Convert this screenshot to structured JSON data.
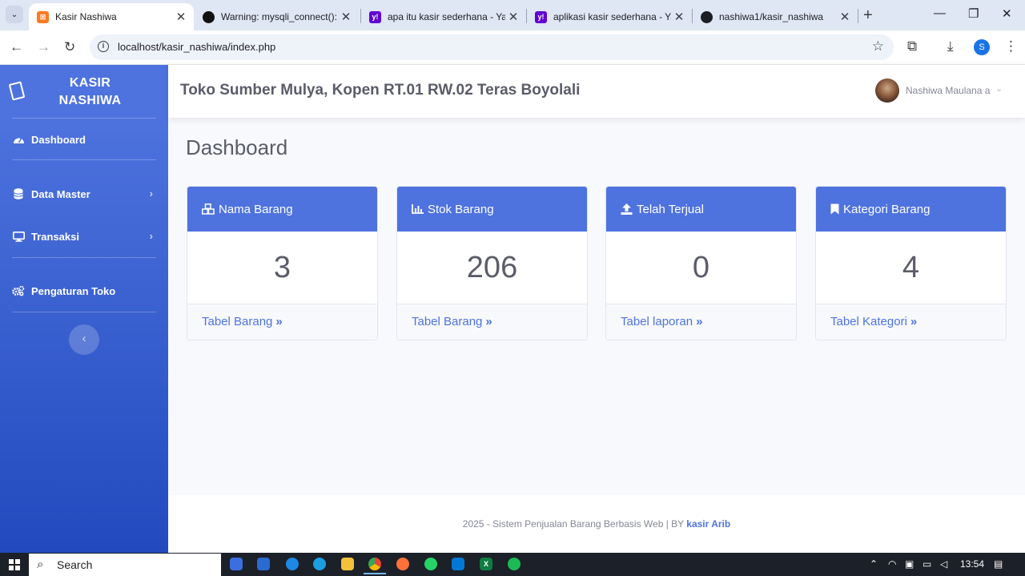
{
  "browser": {
    "tabs": [
      {
        "title": "Kasir Nashiwa",
        "favicon": "xampp-icon",
        "active": true
      },
      {
        "title": "Warning: mysqli_connect(): (",
        "favicon": "web-icon",
        "active": false
      },
      {
        "title": "apa itu kasir sederhana - Yah",
        "favicon": "yahoo-icon",
        "active": false
      },
      {
        "title": "aplikasi kasir sederhana - Yah",
        "favicon": "yahoo-icon",
        "active": false
      },
      {
        "title": "nashiwa1/kasir_nashiwa",
        "favicon": "github-icon",
        "active": false
      }
    ],
    "url": "localhost/kasir_nashiwa/index.php",
    "profile_initial": "S"
  },
  "sidebar": {
    "brand_line1": "KASIR",
    "brand_line2": "NASHIWA",
    "items": [
      {
        "label": "Dashboard",
        "icon": "tachometer-icon",
        "has_submenu": false
      },
      {
        "label": "Data Master",
        "icon": "database-icon",
        "has_submenu": true
      },
      {
        "label": "Transaksi",
        "icon": "desktop-icon",
        "has_submenu": true
      },
      {
        "label": "Pengaturan Toko",
        "icon": "cogs-icon",
        "has_submenu": false
      }
    ]
  },
  "topbar": {
    "store_name": "Toko Sumber Mulya, Kopen RT.01 RW.02 Teras Boyolali",
    "user_name": "Nashiwa Maulana a"
  },
  "page": {
    "title": "Dashboard"
  },
  "cards": [
    {
      "title": "Nama Barang",
      "icon": "cubes-icon",
      "value": "3",
      "link": "Tabel Barang"
    },
    {
      "title": "Stok Barang",
      "icon": "chart-bar-icon",
      "value": "206",
      "link": "Tabel Barang"
    },
    {
      "title": "Telah Terjual",
      "icon": "upload-icon",
      "value": "0",
      "link": "Tabel laporan"
    },
    {
      "title": "Kategori Barang",
      "icon": "bookmark-icon",
      "value": "4",
      "link": "Tabel Kategori"
    }
  ],
  "footer": {
    "text": "2025 - Sistem Penjualan Barang Berbasis Web | BY ",
    "author": "kasir Arib"
  },
  "taskbar": {
    "search_label": "Search",
    "time": "13:54"
  },
  "colors": {
    "primary": "#4e73df",
    "sidebar_gradient_end": "#224abe",
    "text_gray": "#5a5c69",
    "page_bg": "#f8f9fc"
  }
}
